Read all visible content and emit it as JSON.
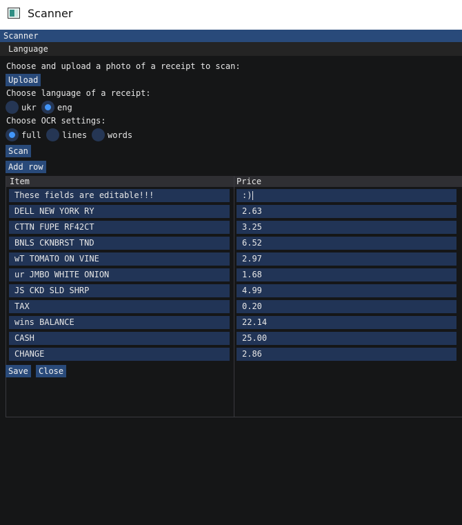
{
  "window": {
    "title": "Scanner"
  },
  "panel": {
    "title": "Scanner"
  },
  "menu": {
    "items": [
      "Language"
    ]
  },
  "upload": {
    "prompt": "Choose and upload a photo of a receipt to scan:",
    "button": "Upload"
  },
  "language": {
    "prompt": "Choose language of a receipt:",
    "options": [
      {
        "label": "ukr",
        "selected": false
      },
      {
        "label": "eng",
        "selected": true
      }
    ]
  },
  "ocr": {
    "prompt": "Choose OCR settings:",
    "options": [
      {
        "label": "full",
        "selected": true
      },
      {
        "label": "lines",
        "selected": false
      },
      {
        "label": "words",
        "selected": false
      }
    ]
  },
  "actions": {
    "scan": "Scan",
    "add_row": "Add row",
    "save": "Save",
    "close": "Close"
  },
  "table": {
    "headers": [
      "Item",
      "Price"
    ],
    "rows": [
      {
        "item": "These fields are editable!!!",
        "price": ":)"
      },
      {
        "item": "DELL NEW YORK RY",
        "price": "2.63"
      },
      {
        "item": "CTTN FUPE RF42CT",
        "price": "3.25"
      },
      {
        "item": "BNLS CKNBRST TND",
        "price": "6.52"
      },
      {
        "item": "wT TOMATO ON VINE",
        "price": "2.97"
      },
      {
        "item": "ur JMBO WHITE ONION",
        "price": "1.68"
      },
      {
        "item": "JS CKD SLD SHRP",
        "price": "4.99"
      },
      {
        "item": "TAX",
        "price": "0.20"
      },
      {
        "item": "wins BALANCE",
        "price": "22.14"
      },
      {
        "item": "CASH",
        "price": "25.00"
      },
      {
        "item": "CHANGE",
        "price": "2.86"
      }
    ]
  },
  "colors": {
    "accent": "#294a7a",
    "radio_on": "#4296fa",
    "field_bg": "#213456",
    "background": "#151617"
  }
}
